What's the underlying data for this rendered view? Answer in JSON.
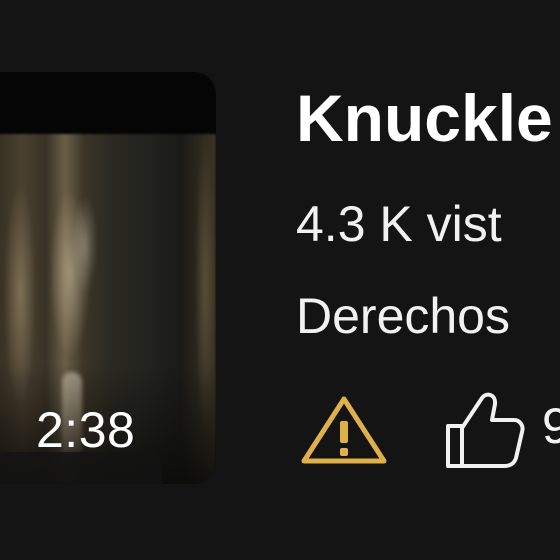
{
  "video": {
    "duration": "2:38",
    "title": "Knuckle",
    "views": "4.3 K vist",
    "channel": "Derechos",
    "like_count_partial": "9"
  },
  "icons": {
    "warning": "warning-triangle-icon",
    "like": "thumbs-up-icon"
  },
  "colors": {
    "background": "#141414",
    "text": "#ffffff",
    "warning": "#e0b04a",
    "icon_stroke": "#f1f1f1"
  }
}
